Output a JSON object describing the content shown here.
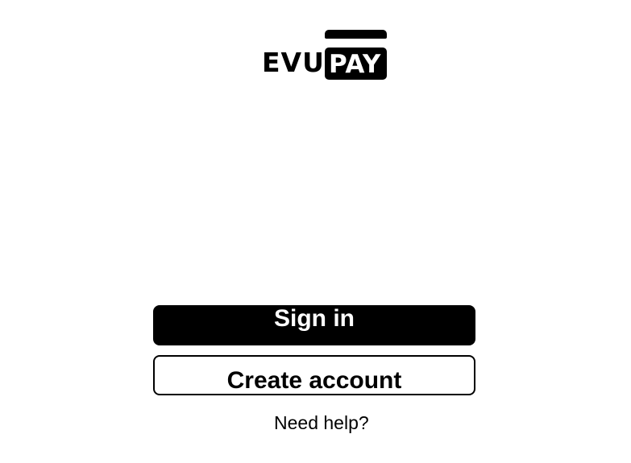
{
  "brand": {
    "logo_part1": "EVU",
    "logo_part2": "PAY",
    "color_primary": "#000000",
    "color_background": "#ffffff"
  },
  "actions": {
    "signin_label": "Sign in",
    "create_account_label": "Create account",
    "help_label": "Need help?"
  }
}
